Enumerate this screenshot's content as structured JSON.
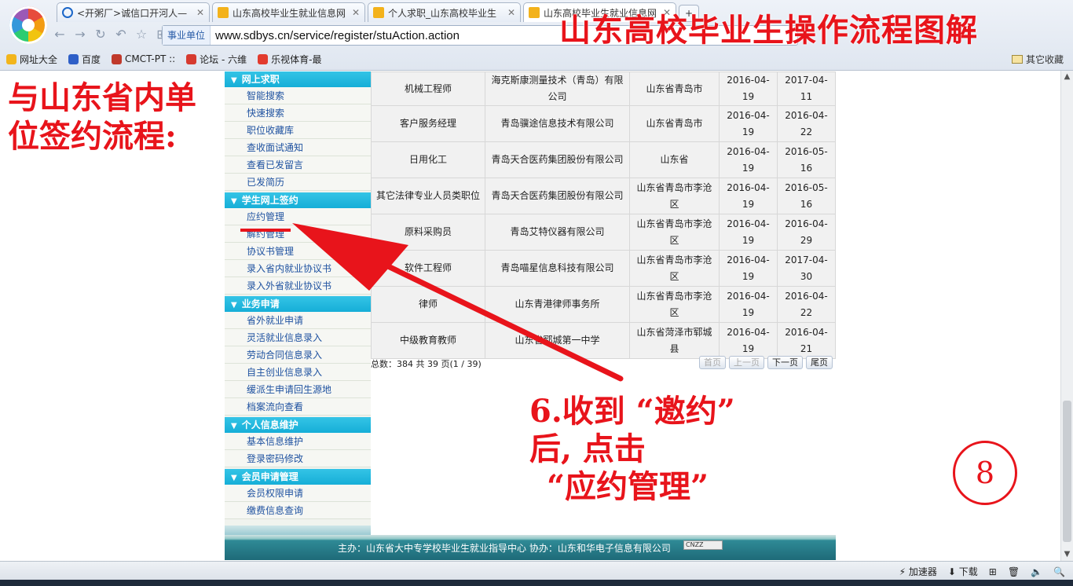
{
  "browser": {
    "tabs": [
      {
        "label": "<开粥厂>诚信口开河人—",
        "active": false
      },
      {
        "label": "山东高校毕业生就业信息网",
        "active": false
      },
      {
        "label": "个人求职_山东高校毕业生",
        "active": false
      },
      {
        "label": "山东高校毕业生就业信息网",
        "active": true
      }
    ],
    "new_tab": "+",
    "address": {
      "tag": "事业单位",
      "url": "www.sdbys.cn/service/register/stuAction.action"
    },
    "bookmarks": [
      "网址大全",
      "百度",
      "CMCT-PT ::",
      "论坛 - 六维",
      "乐视体育-最"
    ],
    "other_bookmarks": "其它收藏",
    "status": {
      "accelerator": "加速器",
      "download": "下载"
    }
  },
  "overlay": {
    "banner": "山东高校毕业生操作流程图解",
    "left_note": [
      "与山东省内单",
      "位签约流程:"
    ],
    "step_lines": [
      "6.收到 “邀约”",
      "后, 点击",
      "“应约管理”"
    ],
    "circled_number": "8"
  },
  "sidebar": {
    "sections": [
      {
        "title": "网上求职",
        "items": [
          "智能搜索",
          "快速搜索",
          "职位收藏库",
          "查收面试通知",
          "查看已发留言",
          "已发简历"
        ]
      },
      {
        "title": "学生网上签约",
        "items": [
          "应约管理",
          "解约管理",
          "协议书管理",
          "录入省内就业协议书",
          "录入外省就业协议书"
        ]
      },
      {
        "title": "业务申请",
        "items": [
          "省外就业申请",
          "灵活就业信息录入",
          "劳动合同信息录入",
          "自主创业信息录入",
          "缓派生申请回生源地",
          "档案流向查看"
        ]
      },
      {
        "title": "个人信息维护",
        "items": [
          "基本信息维护",
          "登录密码修改"
        ]
      },
      {
        "title": "会员申请管理",
        "items": [
          "会员权限申请",
          "缴费信息查询"
        ]
      }
    ]
  },
  "table": {
    "rows": [
      {
        "position": "机械工程师",
        "company": "海克斯康测量技术（青岛）有限公司",
        "location": "山东省青岛市",
        "date1": "2016-04-19",
        "date2": "2017-04-11"
      },
      {
        "position": "客户服务经理",
        "company": "青岛骥途信息技术有限公司",
        "location": "山东省青岛市",
        "date1": "2016-04-19",
        "date2": "2016-04-22"
      },
      {
        "position": "日用化工",
        "company": "青岛天合医药集团股份有限公司",
        "location": "山东省",
        "date1": "2016-04-19",
        "date2": "2016-05-16"
      },
      {
        "position": "其它法律专业人员类职位",
        "company": "青岛天合医药集团股份有限公司",
        "location": "山东省青岛市李沧区",
        "date1": "2016-04-19",
        "date2": "2016-05-16"
      },
      {
        "position": "原料采购员",
        "company": "青岛艾特仪器有限公司",
        "location": "山东省青岛市李沧区",
        "date1": "2016-04-19",
        "date2": "2016-04-29"
      },
      {
        "position": "软件工程师",
        "company": "青岛喵星信息科技有限公司",
        "location": "山东省青岛市李沧区",
        "date1": "2016-04-19",
        "date2": "2017-04-30"
      },
      {
        "position": "律师",
        "company": "山东青港律师事务所",
        "location": "山东省青岛市李沧区",
        "date1": "2016-04-19",
        "date2": "2016-04-22"
      },
      {
        "position": "中级教育教师",
        "company": "山东省郓城第一中学",
        "location": "山东省菏泽市郓城县",
        "date1": "2016-04-19",
        "date2": "2016-04-21"
      }
    ]
  },
  "pager": {
    "info": "总数：384   共 39 页(1 / 39)",
    "first": "首页",
    "prev": "上一页",
    "next": "下一页",
    "last": "尾页"
  },
  "footer": {
    "text": "主办：山东省大中专学校毕业生就业指导中心  协办：山东和华电子信息有限公司",
    "badge": "CNZZ"
  },
  "colors": {
    "annotation": "#e8141b",
    "section_header": "#1aaed8",
    "link": "#1f52a0"
  }
}
